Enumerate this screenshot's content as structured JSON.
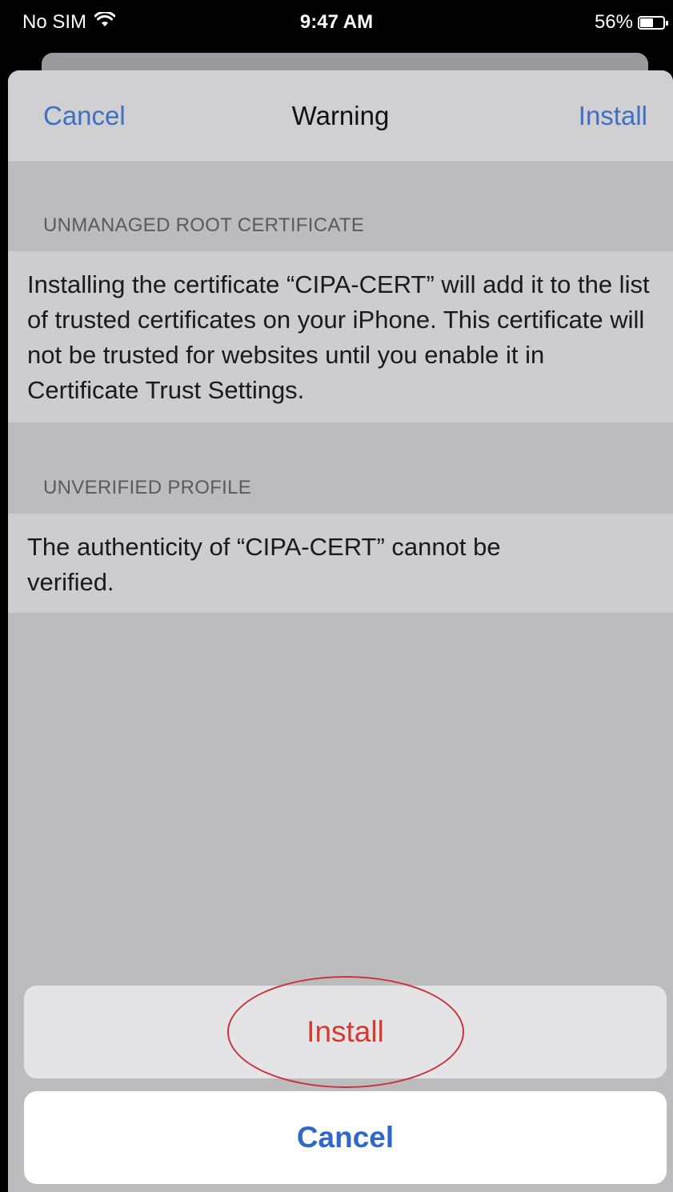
{
  "status_bar": {
    "carrier": "No SIM",
    "time": "9:47 AM",
    "battery_percent": "56%",
    "battery_level": 0.56,
    "wifi_icon": "wifi-icon"
  },
  "nav": {
    "cancel_label": "Cancel",
    "title": "Warning",
    "install_label": "Install"
  },
  "sections": [
    {
      "header": "UNMANAGED ROOT CERTIFICATE",
      "body": "Installing the certificate “CIPA-CERT” will add it to the list of trusted certificates on your iPhone. This certificate will not be trusted for websites until you enable it in Certificate Trust Settings."
    },
    {
      "header": "UNVERIFIED PROFILE",
      "body": "The authenticity of “CIPA-CERT” cannot be verified."
    }
  ],
  "action_sheet": {
    "install_label": "Install",
    "cancel_label": "Cancel"
  },
  "colors": {
    "accent_blue": "#3e6fc2",
    "destructive_red": "#d43a2f",
    "annotation_circle": "#c8323c"
  }
}
